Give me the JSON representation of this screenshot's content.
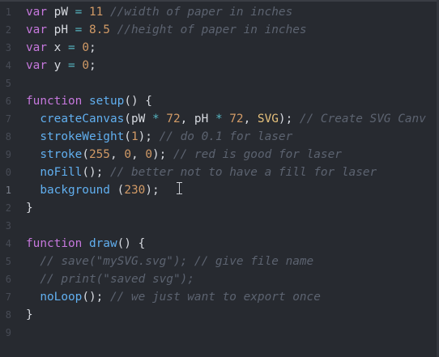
{
  "editor": {
    "lines": [
      {
        "n": "1",
        "segs": [
          [
            "kw",
            "var "
          ],
          [
            "ib",
            "pW "
          ],
          [
            "op",
            "= "
          ],
          [
            "num",
            "11 "
          ],
          [
            "cm",
            "//width of paper in inches"
          ]
        ]
      },
      {
        "n": "2",
        "segs": [
          [
            "kw",
            "var "
          ],
          [
            "ib",
            "pH "
          ],
          [
            "op",
            "= "
          ],
          [
            "num",
            "8.5 "
          ],
          [
            "cm",
            "//height of paper in inches"
          ]
        ]
      },
      {
        "n": "3",
        "segs": [
          [
            "kw",
            "var "
          ],
          [
            "ib",
            "x "
          ],
          [
            "op",
            "= "
          ],
          [
            "num",
            "0"
          ],
          [
            "ib",
            ";"
          ]
        ]
      },
      {
        "n": "4",
        "segs": [
          [
            "kw",
            "var "
          ],
          [
            "ib",
            "y "
          ],
          [
            "op",
            "= "
          ],
          [
            "num",
            "0"
          ],
          [
            "ib",
            ";"
          ]
        ]
      },
      {
        "n": "5",
        "segs": []
      },
      {
        "n": "6",
        "segs": [
          [
            "kw",
            "function "
          ],
          [
            "fn",
            "setup"
          ],
          [
            "ib",
            "() {"
          ]
        ]
      },
      {
        "n": "7",
        "segs": [
          [
            "ib",
            "  "
          ],
          [
            "fn",
            "createCanvas"
          ],
          [
            "ib",
            "(pW "
          ],
          [
            "op",
            "* "
          ],
          [
            "num",
            "72"
          ],
          [
            "ib",
            ", pH "
          ],
          [
            "op",
            "* "
          ],
          [
            "num",
            "72"
          ],
          [
            "ib",
            ", "
          ],
          [
            "cn",
            "SVG"
          ],
          [
            "ib",
            "); "
          ],
          [
            "cm",
            "// Create SVG Canv"
          ]
        ]
      },
      {
        "n": "8",
        "segs": [
          [
            "ib",
            "  "
          ],
          [
            "fn",
            "strokeWeight"
          ],
          [
            "ib",
            "("
          ],
          [
            "num",
            "1"
          ],
          [
            "ib",
            "); "
          ],
          [
            "cm",
            "// do 0.1 for laser"
          ]
        ]
      },
      {
        "n": "9",
        "segs": [
          [
            "ib",
            "  "
          ],
          [
            "fn",
            "stroke"
          ],
          [
            "ib",
            "("
          ],
          [
            "num",
            "255"
          ],
          [
            "ib",
            ", "
          ],
          [
            "num",
            "0"
          ],
          [
            "ib",
            ", "
          ],
          [
            "num",
            "0"
          ],
          [
            "ib",
            "); "
          ],
          [
            "cm",
            "// red is good for laser"
          ]
        ]
      },
      {
        "n": "0",
        "segs": [
          [
            "ib",
            "  "
          ],
          [
            "fn",
            "noFill"
          ],
          [
            "ib",
            "(); "
          ],
          [
            "cm",
            "// better not to have a fill for laser"
          ]
        ]
      },
      {
        "n": "1",
        "segs": [
          [
            "ib",
            "  "
          ],
          [
            "fn",
            "background "
          ],
          [
            "ib",
            "("
          ],
          [
            "num",
            "230"
          ],
          [
            "ib",
            ");"
          ]
        ]
      },
      {
        "n": "2",
        "segs": [
          [
            "ib",
            "}"
          ]
        ]
      },
      {
        "n": "3",
        "segs": []
      },
      {
        "n": "4",
        "segs": [
          [
            "kw",
            "function "
          ],
          [
            "fn",
            "draw"
          ],
          [
            "ib",
            "() {"
          ]
        ]
      },
      {
        "n": "5",
        "segs": [
          [
            "ib",
            "  "
          ],
          [
            "cm",
            "// save(\"mySVG.svg\"); // give file name"
          ]
        ]
      },
      {
        "n": "6",
        "segs": [
          [
            "ib",
            "  "
          ],
          [
            "cm",
            "// print(\"saved svg\");"
          ]
        ]
      },
      {
        "n": "7",
        "segs": [
          [
            "ib",
            "  "
          ],
          [
            "fn",
            "noLoop"
          ],
          [
            "ib",
            "(); "
          ],
          [
            "cm",
            "// we just want to export once"
          ]
        ]
      },
      {
        "n": "8",
        "segs": [
          [
            "ib",
            "}"
          ]
        ]
      },
      {
        "n": "9",
        "segs": []
      }
    ],
    "active_line_index": 10
  }
}
